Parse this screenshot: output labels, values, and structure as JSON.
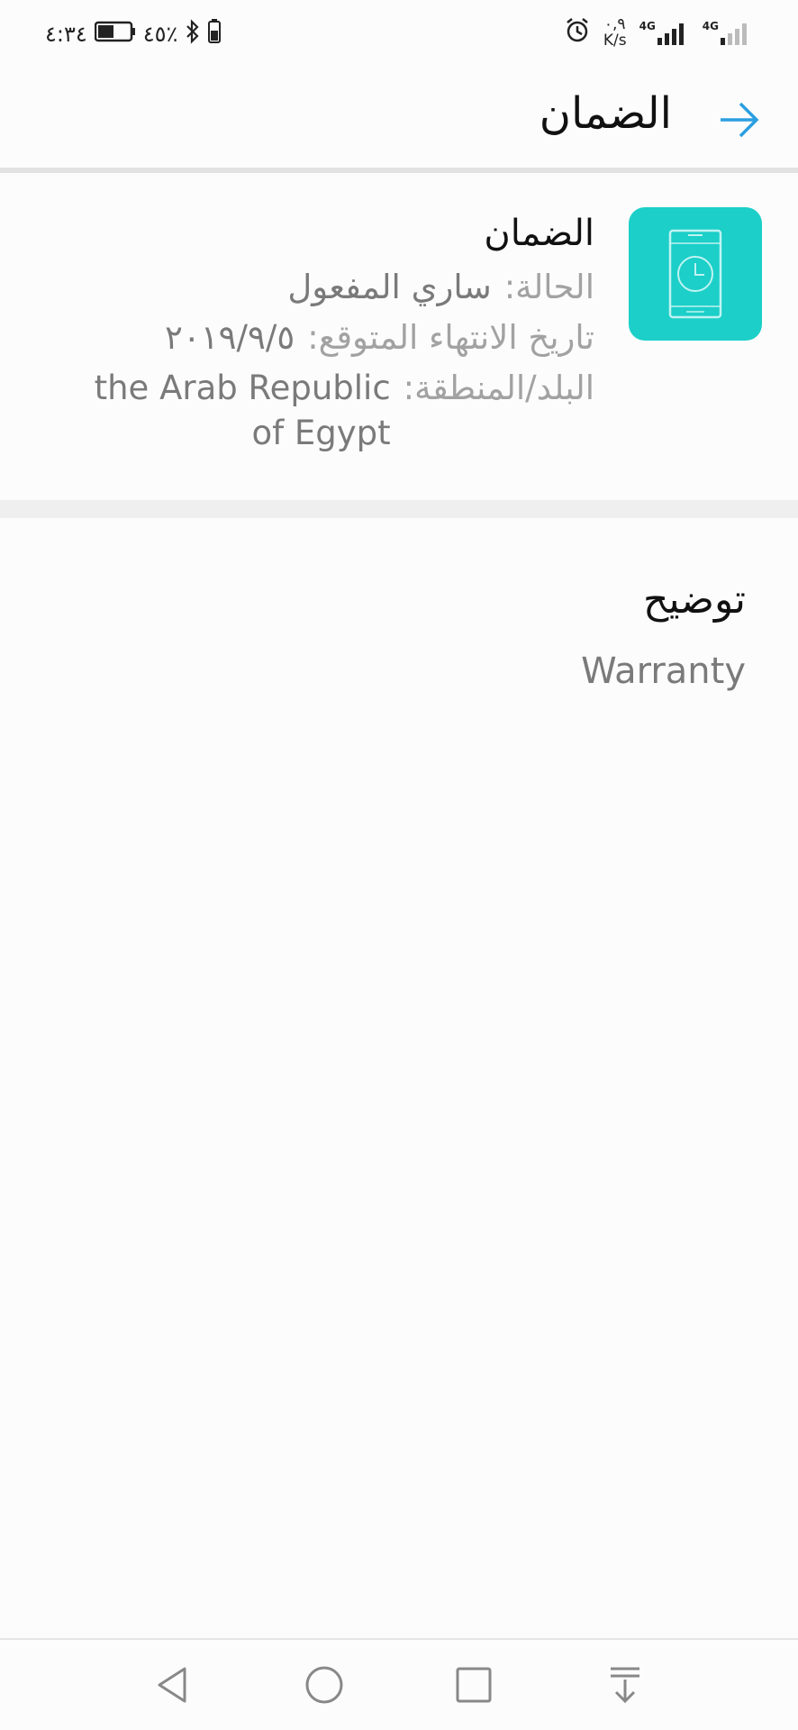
{
  "status_bar": {
    "time": "٤:٣٤",
    "battery": "٤٥٪",
    "speed_value": "٠,٩",
    "speed_unit": "K/s",
    "net1": "4G",
    "net2": "4G"
  },
  "app_bar": {
    "title": "الضمان",
    "back_icon": "arrow-right-icon"
  },
  "warranty": {
    "title": "الضمان",
    "status_label": "الحالة:",
    "status_value": "ساري المفعول",
    "expiry_label": "تاريخ الانتهاء المتوقع:",
    "expiry_value": "٢٠١٩/٩/٥",
    "region_label": "البلد/المنطقة:",
    "region_value": "the Arab Republic of Egypt",
    "icon": "phone-clock-icon",
    "icon_color": "#1ccfc9"
  },
  "description": {
    "heading": "توضيح",
    "text": "Warranty"
  },
  "nav_bar": {
    "back_icon": "triangle-back-icon",
    "home_icon": "circle-home-icon",
    "recents_icon": "square-recents-icon",
    "notifications_icon": "pull-down-icon"
  },
  "colors": {
    "accent": "#2a9ee0",
    "teal": "#1ccfc9"
  }
}
